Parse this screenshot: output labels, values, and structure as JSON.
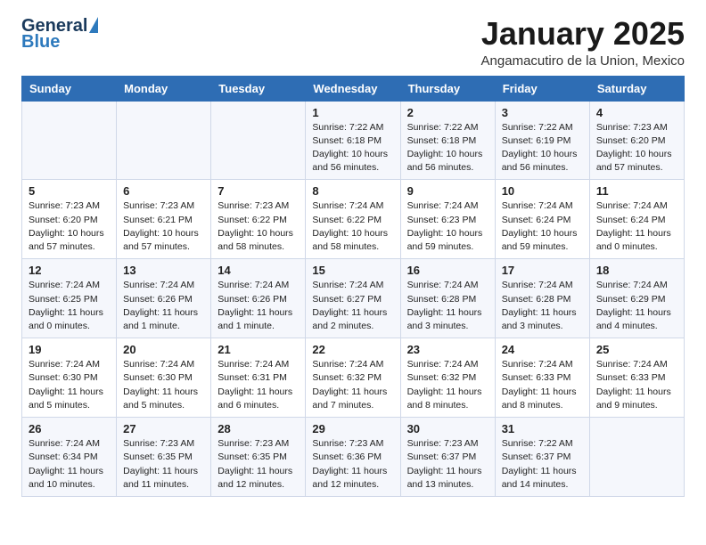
{
  "header": {
    "logo_general": "General",
    "logo_blue": "Blue",
    "title": "January 2025",
    "subtitle": "Angamacutiro de la Union, Mexico"
  },
  "weekdays": [
    "Sunday",
    "Monday",
    "Tuesday",
    "Wednesday",
    "Thursday",
    "Friday",
    "Saturday"
  ],
  "weeks": [
    [
      {
        "day": "",
        "info": ""
      },
      {
        "day": "",
        "info": ""
      },
      {
        "day": "",
        "info": ""
      },
      {
        "day": "1",
        "info": "Sunrise: 7:22 AM\nSunset: 6:18 PM\nDaylight: 10 hours\nand 56 minutes."
      },
      {
        "day": "2",
        "info": "Sunrise: 7:22 AM\nSunset: 6:18 PM\nDaylight: 10 hours\nand 56 minutes."
      },
      {
        "day": "3",
        "info": "Sunrise: 7:22 AM\nSunset: 6:19 PM\nDaylight: 10 hours\nand 56 minutes."
      },
      {
        "day": "4",
        "info": "Sunrise: 7:23 AM\nSunset: 6:20 PM\nDaylight: 10 hours\nand 57 minutes."
      }
    ],
    [
      {
        "day": "5",
        "info": "Sunrise: 7:23 AM\nSunset: 6:20 PM\nDaylight: 10 hours\nand 57 minutes."
      },
      {
        "day": "6",
        "info": "Sunrise: 7:23 AM\nSunset: 6:21 PM\nDaylight: 10 hours\nand 57 minutes."
      },
      {
        "day": "7",
        "info": "Sunrise: 7:23 AM\nSunset: 6:22 PM\nDaylight: 10 hours\nand 58 minutes."
      },
      {
        "day": "8",
        "info": "Sunrise: 7:24 AM\nSunset: 6:22 PM\nDaylight: 10 hours\nand 58 minutes."
      },
      {
        "day": "9",
        "info": "Sunrise: 7:24 AM\nSunset: 6:23 PM\nDaylight: 10 hours\nand 59 minutes."
      },
      {
        "day": "10",
        "info": "Sunrise: 7:24 AM\nSunset: 6:24 PM\nDaylight: 10 hours\nand 59 minutes."
      },
      {
        "day": "11",
        "info": "Sunrise: 7:24 AM\nSunset: 6:24 PM\nDaylight: 11 hours\nand 0 minutes."
      }
    ],
    [
      {
        "day": "12",
        "info": "Sunrise: 7:24 AM\nSunset: 6:25 PM\nDaylight: 11 hours\nand 0 minutes."
      },
      {
        "day": "13",
        "info": "Sunrise: 7:24 AM\nSunset: 6:26 PM\nDaylight: 11 hours\nand 1 minute."
      },
      {
        "day": "14",
        "info": "Sunrise: 7:24 AM\nSunset: 6:26 PM\nDaylight: 11 hours\nand 1 minute."
      },
      {
        "day": "15",
        "info": "Sunrise: 7:24 AM\nSunset: 6:27 PM\nDaylight: 11 hours\nand 2 minutes."
      },
      {
        "day": "16",
        "info": "Sunrise: 7:24 AM\nSunset: 6:28 PM\nDaylight: 11 hours\nand 3 minutes."
      },
      {
        "day": "17",
        "info": "Sunrise: 7:24 AM\nSunset: 6:28 PM\nDaylight: 11 hours\nand 3 minutes."
      },
      {
        "day": "18",
        "info": "Sunrise: 7:24 AM\nSunset: 6:29 PM\nDaylight: 11 hours\nand 4 minutes."
      }
    ],
    [
      {
        "day": "19",
        "info": "Sunrise: 7:24 AM\nSunset: 6:30 PM\nDaylight: 11 hours\nand 5 minutes."
      },
      {
        "day": "20",
        "info": "Sunrise: 7:24 AM\nSunset: 6:30 PM\nDaylight: 11 hours\nand 5 minutes."
      },
      {
        "day": "21",
        "info": "Sunrise: 7:24 AM\nSunset: 6:31 PM\nDaylight: 11 hours\nand 6 minutes."
      },
      {
        "day": "22",
        "info": "Sunrise: 7:24 AM\nSunset: 6:32 PM\nDaylight: 11 hours\nand 7 minutes."
      },
      {
        "day": "23",
        "info": "Sunrise: 7:24 AM\nSunset: 6:32 PM\nDaylight: 11 hours\nand 8 minutes."
      },
      {
        "day": "24",
        "info": "Sunrise: 7:24 AM\nSunset: 6:33 PM\nDaylight: 11 hours\nand 8 minutes."
      },
      {
        "day": "25",
        "info": "Sunrise: 7:24 AM\nSunset: 6:33 PM\nDaylight: 11 hours\nand 9 minutes."
      }
    ],
    [
      {
        "day": "26",
        "info": "Sunrise: 7:24 AM\nSunset: 6:34 PM\nDaylight: 11 hours\nand 10 minutes."
      },
      {
        "day": "27",
        "info": "Sunrise: 7:23 AM\nSunset: 6:35 PM\nDaylight: 11 hours\nand 11 minutes."
      },
      {
        "day": "28",
        "info": "Sunrise: 7:23 AM\nSunset: 6:35 PM\nDaylight: 11 hours\nand 12 minutes."
      },
      {
        "day": "29",
        "info": "Sunrise: 7:23 AM\nSunset: 6:36 PM\nDaylight: 11 hours\nand 12 minutes."
      },
      {
        "day": "30",
        "info": "Sunrise: 7:23 AM\nSunset: 6:37 PM\nDaylight: 11 hours\nand 13 minutes."
      },
      {
        "day": "31",
        "info": "Sunrise: 7:22 AM\nSunset: 6:37 PM\nDaylight: 11 hours\nand 14 minutes."
      },
      {
        "day": "",
        "info": ""
      }
    ]
  ]
}
